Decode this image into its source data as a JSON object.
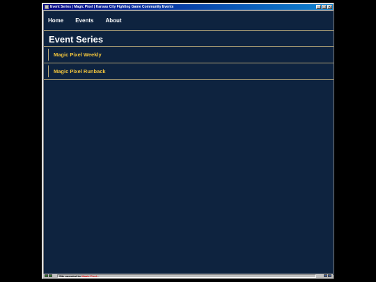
{
  "window": {
    "title": "Event Series | Magic Pixel | Kansas City Fighting Game Community Events",
    "controls": [
      "_",
      "□",
      "×"
    ]
  },
  "nav": {
    "items": [
      {
        "label": "Home"
      },
      {
        "label": "Events"
      },
      {
        "label": "About"
      }
    ]
  },
  "page": {
    "title": "Event Series"
  },
  "series": [
    {
      "label": "Magic Pixel Weekly"
    },
    {
      "label": "Magic Pixel Runback"
    }
  ],
  "status": {
    "prefix": "Site operated by ",
    "link": "Magic Pixel..."
  },
  "colors": {
    "background": "#0e233f",
    "accent_gold": "#f0c33c",
    "divider": "#b9a97a",
    "title_bar": "#000080"
  }
}
